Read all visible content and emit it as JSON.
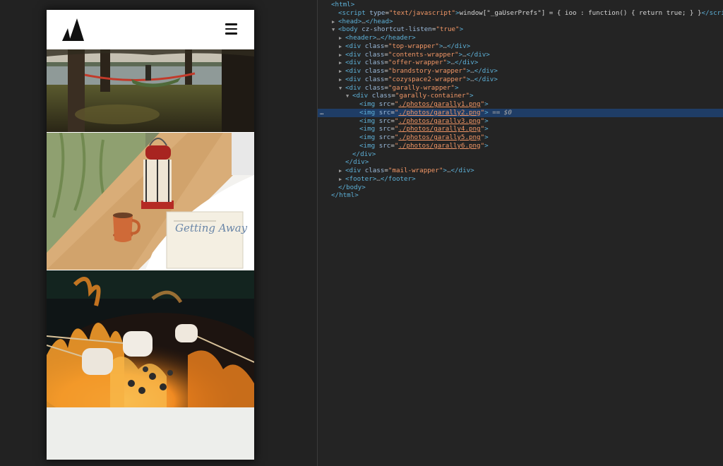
{
  "devtools": {
    "lines": [
      {
        "id": "html-open",
        "indent": 0,
        "tri": "",
        "tag": "html",
        "open": true,
        "close": false
      },
      {
        "id": "script",
        "indent": 1,
        "tri": "",
        "tag": "script",
        "attrs": [
          {
            "name": "type",
            "value": "\"text/javascript\""
          }
        ],
        "text": "window[\"_gaUserPrefs\"] = { ioo : function() { return true; } }",
        "closeTag": "script"
      },
      {
        "id": "head",
        "indent": 1,
        "tri": "▶",
        "tag": "head",
        "collapsed": true,
        "closeTag": "head"
      },
      {
        "id": "body",
        "indent": 1,
        "tri": "▼",
        "tag": "body",
        "attrs": [
          {
            "name": "cz-shortcut-listen",
            "value": "\"true\""
          }
        ]
      },
      {
        "id": "header",
        "indent": 2,
        "tri": "▶",
        "tag": "header",
        "collapsed": true,
        "closeTag": "header"
      },
      {
        "id": "top-wrapper",
        "indent": 2,
        "tri": "▶",
        "tag": "div",
        "attrs": [
          {
            "name": "class",
            "value": "\"top-wrapper\""
          }
        ],
        "collapsed": true,
        "closeTag": "div"
      },
      {
        "id": "contents-wrapper",
        "indent": 2,
        "tri": "▶",
        "tag": "div",
        "attrs": [
          {
            "name": "class",
            "value": "\"contents-wrapper\""
          }
        ],
        "collapsed": true,
        "closeTag": "div"
      },
      {
        "id": "offer-wrapper",
        "indent": 2,
        "tri": "▶",
        "tag": "div",
        "attrs": [
          {
            "name": "class",
            "value": "\"offer-wrapper\""
          }
        ],
        "collapsed": true,
        "closeTag": "div"
      },
      {
        "id": "brandstory-wrapper",
        "indent": 2,
        "tri": "▶",
        "tag": "div",
        "attrs": [
          {
            "name": "class",
            "value": "\"brandstory-wrapper\""
          }
        ],
        "collapsed": true,
        "closeTag": "div"
      },
      {
        "id": "cozyspace2-wrapper",
        "indent": 2,
        "tri": "▶",
        "tag": "div",
        "attrs": [
          {
            "name": "class",
            "value": "\"cozyspace2-wrapper\""
          }
        ],
        "collapsed": true,
        "closeTag": "div"
      },
      {
        "id": "garally-wrapper",
        "indent": 2,
        "tri": "▼",
        "tag": "div",
        "attrs": [
          {
            "name": "class",
            "value": "\"garally-wrapper\""
          }
        ]
      },
      {
        "id": "garally-container",
        "indent": 3,
        "tri": "▼",
        "tag": "div",
        "attrs": [
          {
            "name": "class",
            "value": "\"garally-container\""
          }
        ]
      },
      {
        "id": "img1",
        "indent": 4,
        "tri": "",
        "tag": "img",
        "attrs": [
          {
            "name": "src",
            "value": "./photos/garally1.png",
            "link": true
          }
        ]
      },
      {
        "id": "img2",
        "indent": 4,
        "tri": "",
        "tag": "img",
        "attrs": [
          {
            "name": "src",
            "value": "./photos/garally2.png",
            "link": true
          }
        ],
        "selected": true,
        "suffix": " == $0"
      },
      {
        "id": "img3",
        "indent": 4,
        "tri": "",
        "tag": "img",
        "attrs": [
          {
            "name": "src",
            "value": "./photos/garally3.png",
            "link": true
          }
        ]
      },
      {
        "id": "img4",
        "indent": 4,
        "tri": "",
        "tag": "img",
        "attrs": [
          {
            "name": "src",
            "value": "./photos/garally4.png",
            "link": true
          }
        ]
      },
      {
        "id": "img5",
        "indent": 4,
        "tri": "",
        "tag": "img",
        "attrs": [
          {
            "name": "src",
            "value": "./photos/garally5.png",
            "link": true
          }
        ]
      },
      {
        "id": "img6",
        "indent": 4,
        "tri": "",
        "tag": "img",
        "attrs": [
          {
            "name": "src",
            "value": "./photos/garally6.png",
            "link": true
          }
        ]
      },
      {
        "id": "div-close-1",
        "indent": 3,
        "tri": "",
        "closing": "div"
      },
      {
        "id": "div-close-2",
        "indent": 2,
        "tri": "",
        "closing": "div"
      },
      {
        "id": "mail-wrapper",
        "indent": 2,
        "tri": "▶",
        "tag": "div",
        "attrs": [
          {
            "name": "class",
            "value": "\"mail-wrapper\""
          }
        ],
        "collapsed": true,
        "closeTag": "div"
      },
      {
        "id": "footer",
        "indent": 2,
        "tri": "▶",
        "tag": "footer",
        "collapsed": true,
        "closeTag": "footer"
      },
      {
        "id": "body-close",
        "indent": 1,
        "tri": "",
        "closing": "body"
      },
      {
        "id": "html-close",
        "indent": 0,
        "tri": "",
        "closing": "html"
      }
    ],
    "selected_marker": "…"
  },
  "colors": {
    "panel_bg": "#242424",
    "selection_bg": "#1f3d66",
    "tag": "#5db0d7",
    "attr_name": "#9bbbdc",
    "attr_value": "#f29766"
  },
  "preview": {
    "photos": [
      "hammock by lake",
      "lantern with coffee and book",
      "marshmallows over fire"
    ],
    "book_title": "Getting Away"
  }
}
